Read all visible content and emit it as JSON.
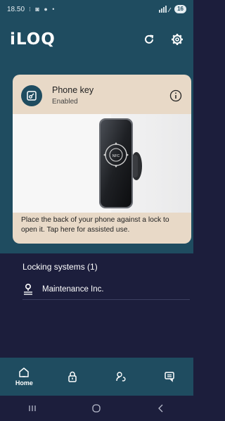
{
  "status_bar": {
    "time": "18.50",
    "left_icons": "⁝ ◙ ● •",
    "battery": "16"
  },
  "app_bar": {
    "logo": "iLOQ",
    "refresh_icon": "refresh-icon",
    "settings_icon": "gear-icon"
  },
  "phone_key_card": {
    "title": "Phone key",
    "status": "Enabled",
    "instruction": "Place the back of your phone against a lock to open it. Tap here for assisted use."
  },
  "locking_systems": {
    "title": "Locking systems (1)",
    "items": [
      {
        "name": "Maintenance Inc."
      }
    ]
  },
  "bottom_nav": {
    "items": [
      {
        "label": "Home",
        "icon": "home-icon",
        "active": true
      },
      {
        "label": "",
        "icon": "lock-icon",
        "active": false
      },
      {
        "label": "",
        "icon": "key-access-icon",
        "active": false
      },
      {
        "label": "",
        "icon": "message-icon",
        "active": false
      }
    ]
  },
  "colors": {
    "header_bg": "#1f4c60",
    "body_bg": "#1c1e3c",
    "card_bg": "#e8d9c7"
  }
}
